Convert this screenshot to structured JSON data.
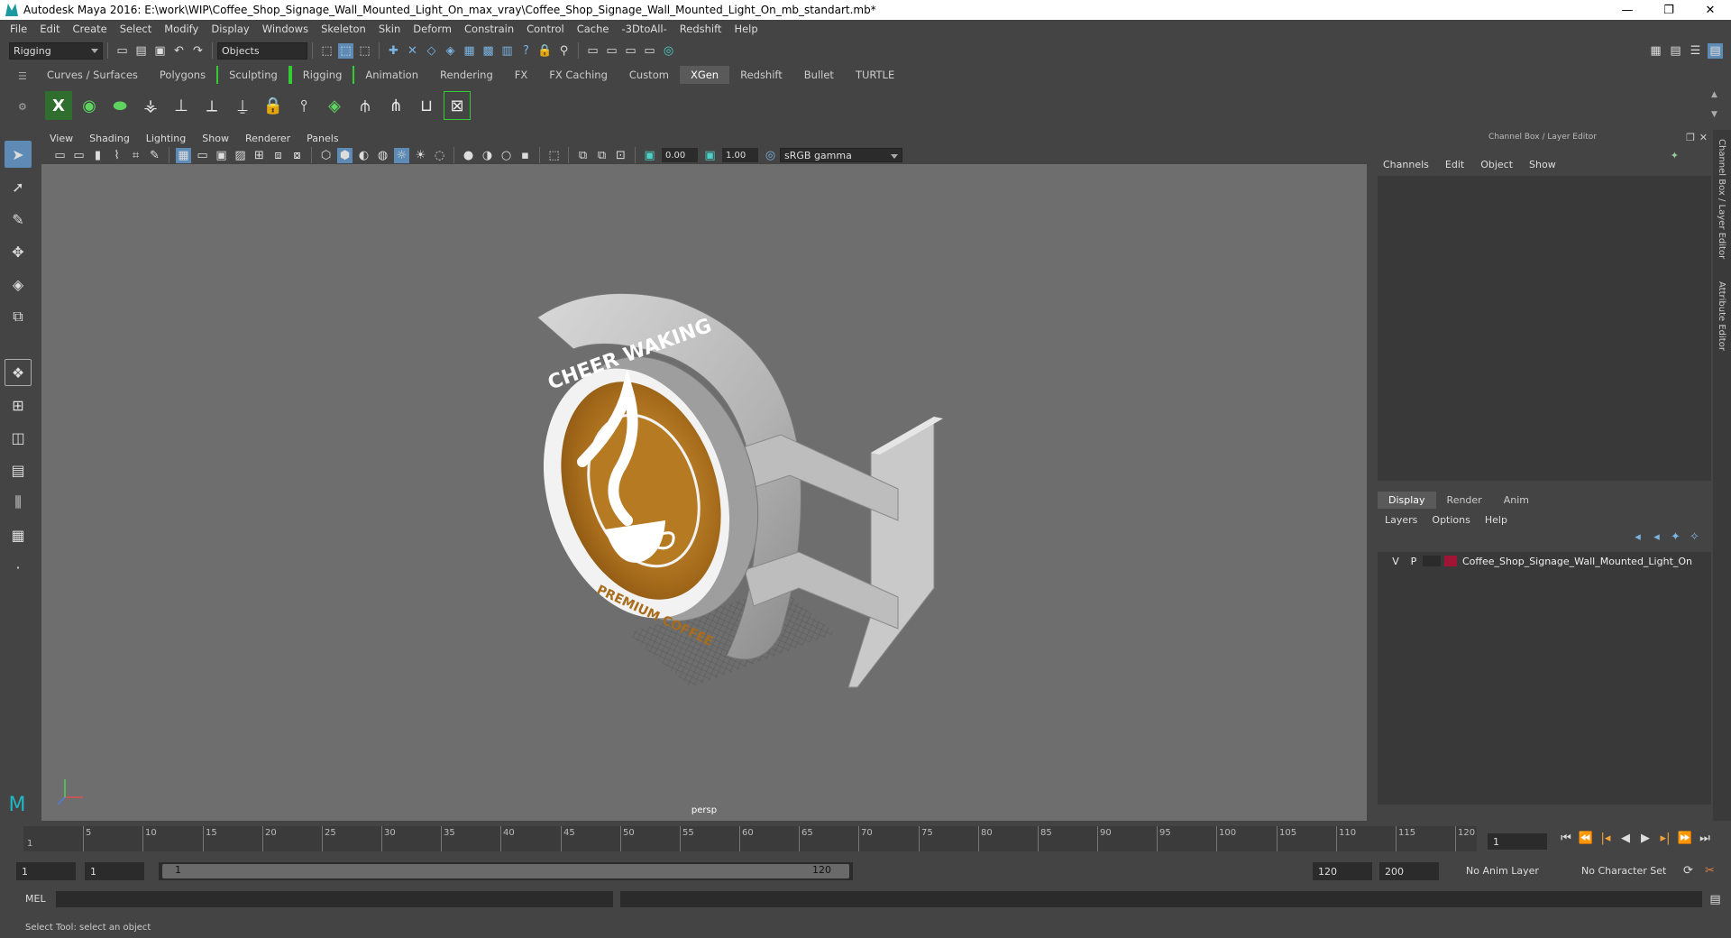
{
  "window": {
    "title": "Autodesk Maya 2016: E:\\work\\WIP\\Coffee_Shop_Signage_Wall_Mounted_Light_On_max_vray\\Coffee_Shop_Signage_Wall_Mounted_Light_On_mb_standart.mb*",
    "minimize": "—",
    "restore": "❐",
    "close": "✕"
  },
  "menubar": [
    "File",
    "Edit",
    "Create",
    "Select",
    "Modify",
    "Display",
    "Windows",
    "Skeleton",
    "Skin",
    "Deform",
    "Constrain",
    "Control",
    "Cache",
    "-3DtoAll-",
    "Redshift",
    "Help"
  ],
  "statusline": {
    "menuset": "Rigging",
    "selection_mode": "Objects"
  },
  "shelf": {
    "tabs": [
      "Curves / Surfaces",
      "Polygons",
      "Sculpting",
      "Rigging",
      "Animation",
      "Rendering",
      "FX",
      "FX Caching",
      "Custom",
      "XGen",
      "Redshift",
      "Bullet",
      "TURTLE"
    ],
    "active_tab": "XGen"
  },
  "viewport": {
    "menus": [
      "View",
      "Shading",
      "Lighting",
      "Show",
      "Renderer",
      "Panels"
    ],
    "exposure": "0.00",
    "gamma": "1.00",
    "colorspace": "sRGB gamma",
    "camera": "persp",
    "sign_top_text": "CHEER WAKING",
    "sign_bottom_text": "PREMIUM COFFEE"
  },
  "channelbox": {
    "header": "Channel Box / Layer Editor",
    "menus": [
      "Channels",
      "Edit",
      "Object",
      "Show"
    ],
    "layer_tabs": [
      "Display",
      "Render",
      "Anim"
    ],
    "active_layer_tab": "Display",
    "layer_menus": [
      "Layers",
      "Options",
      "Help"
    ],
    "layer": {
      "v": "V",
      "p": "P",
      "name": "Coffee_Shop_Signage_Wall_Mounted_Light_On",
      "color": "#a01435"
    }
  },
  "siderail": {
    "tab1": "Channel Box / Layer Editor",
    "tab2": "Attribute Editor"
  },
  "timeline": {
    "ticks": [
      "5",
      "10",
      "15",
      "20",
      "25",
      "30",
      "35",
      "40",
      "45",
      "50",
      "55",
      "60",
      "65",
      "70",
      "75",
      "80",
      "85",
      "90",
      "95",
      "100",
      "105",
      "110",
      "115",
      "120"
    ],
    "start_tick": "1",
    "current_frame": "1"
  },
  "range": {
    "start": "1",
    "playback_start": "1",
    "range_start_value": "1",
    "range_end_value": "120",
    "playback_end": "120",
    "end": "200",
    "anim_layer": "No Anim Layer",
    "character_set": "No Character Set"
  },
  "cmdline": {
    "label": "MEL"
  },
  "helpline": {
    "text": "Select Tool: select an object"
  }
}
